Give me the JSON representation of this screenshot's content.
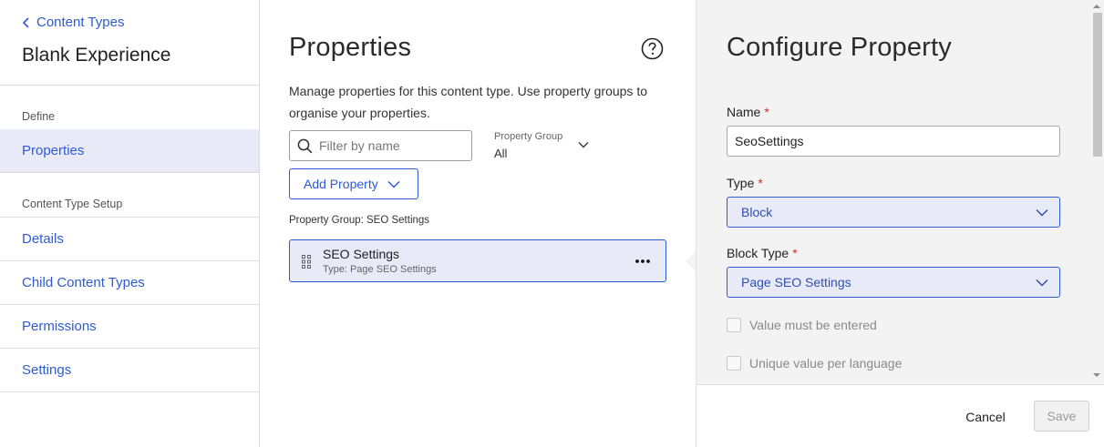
{
  "sidebar": {
    "back_label": "Content Types",
    "title": "Blank Experience",
    "section_define": "Define",
    "item_properties": "Properties",
    "section_setup": "Content Type Setup",
    "items": [
      {
        "label": "Details"
      },
      {
        "label": "Child Content Types"
      },
      {
        "label": "Permissions"
      },
      {
        "label": "Settings"
      }
    ]
  },
  "properties_panel": {
    "title": "Properties",
    "description": "Manage properties for this content type. Use property groups to organise your properties.",
    "filter_placeholder": "Filter by name",
    "property_group_label": "Property Group",
    "property_group_value": "All",
    "add_property_label": "Add Property",
    "group_heading": "Property Group: SEO Settings",
    "property": {
      "name": "SEO Settings",
      "type": "Type: Page SEO Settings"
    }
  },
  "configure_panel": {
    "title": "Configure Property",
    "name_label": "Name",
    "name_value": "SeoSettings",
    "type_label": "Type",
    "type_value": "Block",
    "block_type_label": "Block Type",
    "block_type_value": "Page SEO Settings",
    "required_mark": "*",
    "check_required": "Value must be entered",
    "check_unique": "Unique value per language",
    "cancel_label": "Cancel",
    "save_label": "Save"
  },
  "colors": {
    "accent": "#2e5bd3",
    "selected_bg": "#e8eaf8",
    "required": "#d03030",
    "panel_bg": "#f3f3f3"
  }
}
